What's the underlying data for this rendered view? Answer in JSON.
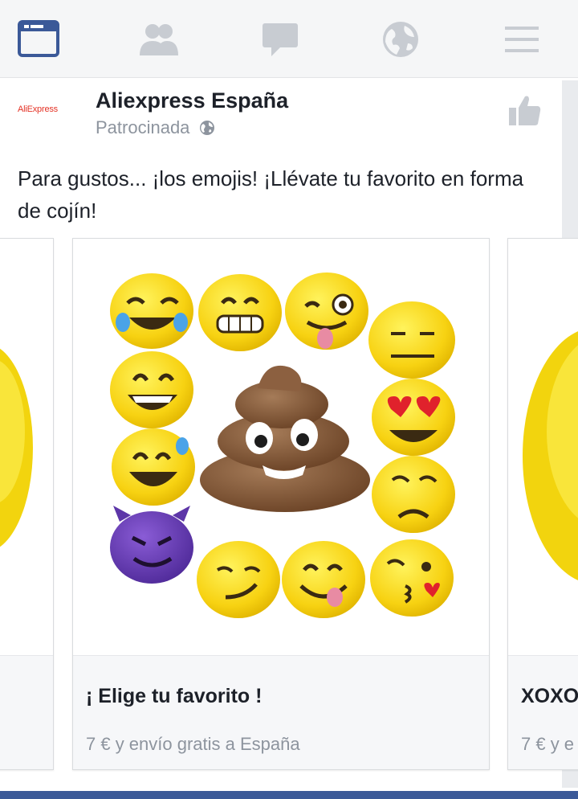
{
  "colors": {
    "brand": "#3b5998",
    "icon_inactive": "#c8ccd2",
    "text": "#1d2129",
    "muted": "#8d949e"
  },
  "nav": {
    "items": [
      {
        "name": "news-feed-icon",
        "active": true
      },
      {
        "name": "friends-icon",
        "active": false
      },
      {
        "name": "messages-icon",
        "active": false
      },
      {
        "name": "notifications-globe-icon",
        "active": false
      },
      {
        "name": "menu-icon",
        "active": false
      }
    ]
  },
  "post": {
    "logo_text": "AliExpress",
    "page_name": "Aliexpress España",
    "sponsored": "Patrocinada",
    "text": "Para gustos... ¡los emojis! ¡Llévate tu favorito en forma de cojín!"
  },
  "carousel": {
    "main": {
      "title": "¡ Elige tu favorito !",
      "price": "7 €  y envío gratis a España"
    },
    "next": {
      "title": "XOXO",
      "price": "7 € y e"
    }
  }
}
